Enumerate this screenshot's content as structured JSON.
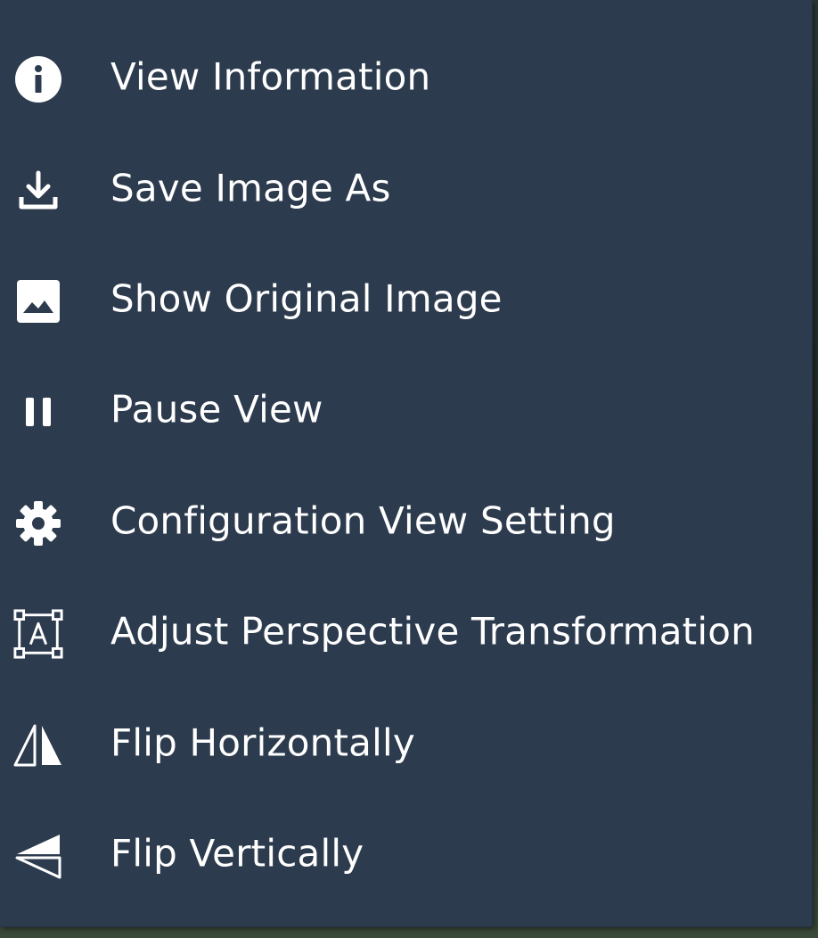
{
  "menu": {
    "background": "#2d3b4e",
    "text_color": "#ffffff",
    "items": [
      {
        "label": "View Information",
        "icon": "info-icon"
      },
      {
        "label": "Save Image As",
        "icon": "download-icon"
      },
      {
        "label": "Show Original Image",
        "icon": "image-icon"
      },
      {
        "label": "Pause View",
        "icon": "pause-icon"
      },
      {
        "label": "Configuration View Setting",
        "icon": "gear-icon"
      },
      {
        "label": "Adjust Perspective Transformation",
        "icon": "perspective-transform-icon"
      },
      {
        "label": "Flip Horizontally",
        "icon": "flip-horizontal-icon"
      },
      {
        "label": "Flip Vertically",
        "icon": "flip-vertical-icon"
      }
    ]
  }
}
